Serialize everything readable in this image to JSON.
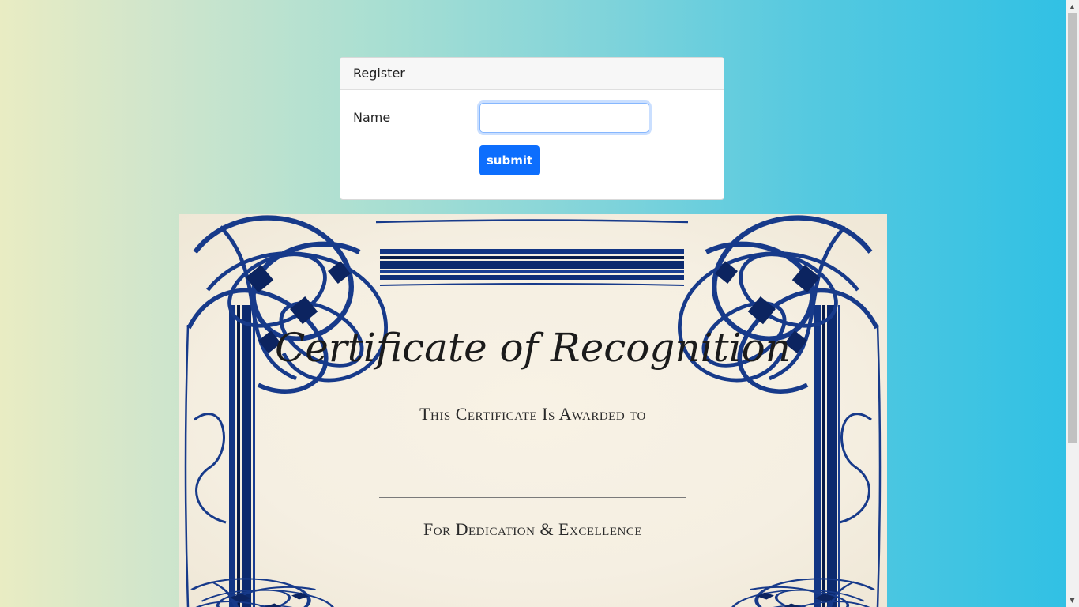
{
  "register_card": {
    "header": "Register",
    "name_label": "Name",
    "name_value": "",
    "submit_label": "submit"
  },
  "certificate": {
    "title": "Certificate of Recognition",
    "awarded_text": "This Certificate Is Awarded to",
    "footer_text": "For Dedication & Excellence"
  },
  "colors": {
    "primary_button": "#0d6efd",
    "border_navy": "#0f2a6b",
    "paper": "#f7f1e4"
  },
  "icons": {
    "scroll_up": "scroll-up-arrow-icon",
    "scroll_down": "scroll-down-arrow-icon"
  }
}
